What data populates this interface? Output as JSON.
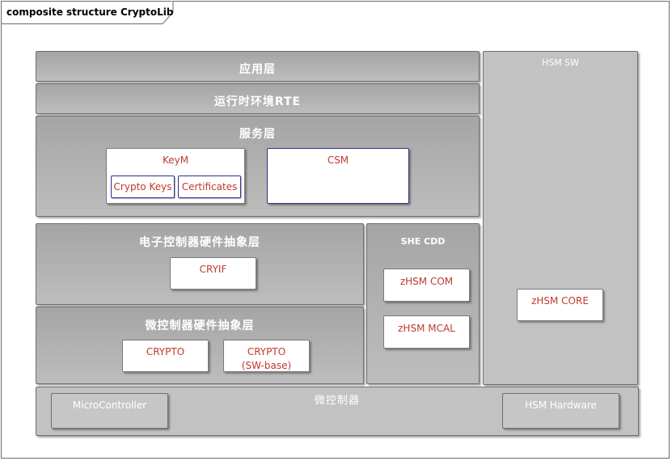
{
  "diagram": {
    "frame_title": "composite structure CryptoLib",
    "hsm_sw": {
      "title": "HSM SW",
      "core": "zHSM CORE"
    },
    "app_layer": {
      "title": "应用层"
    },
    "rte_layer": {
      "title": "运行时环境RTE"
    },
    "service_layer": {
      "title": "服务层",
      "keym": {
        "label": "KeyM",
        "crypto_keys": "Crypto Keys",
        "certificates": "Certificates"
      },
      "csm": {
        "label": "CSM"
      }
    },
    "ecu_abstraction": {
      "title": "电子控制器硬件抽象层",
      "cryif": "CRYIF"
    },
    "she_cdd": {
      "title": "SHE CDD",
      "com": "zHSM COM",
      "mcal": "zHSM MCAL"
    },
    "mcu_abstraction": {
      "title": "微控制器硬件抽象层",
      "crypto": "CRYPTO",
      "crypto_sw_line1": "CRYPTO",
      "crypto_sw_line2": "(SW-base)"
    },
    "microcontroller": {
      "title": "微控制器",
      "mc": "MicroController",
      "hsm_hw": "HSM Hardware"
    }
  }
}
